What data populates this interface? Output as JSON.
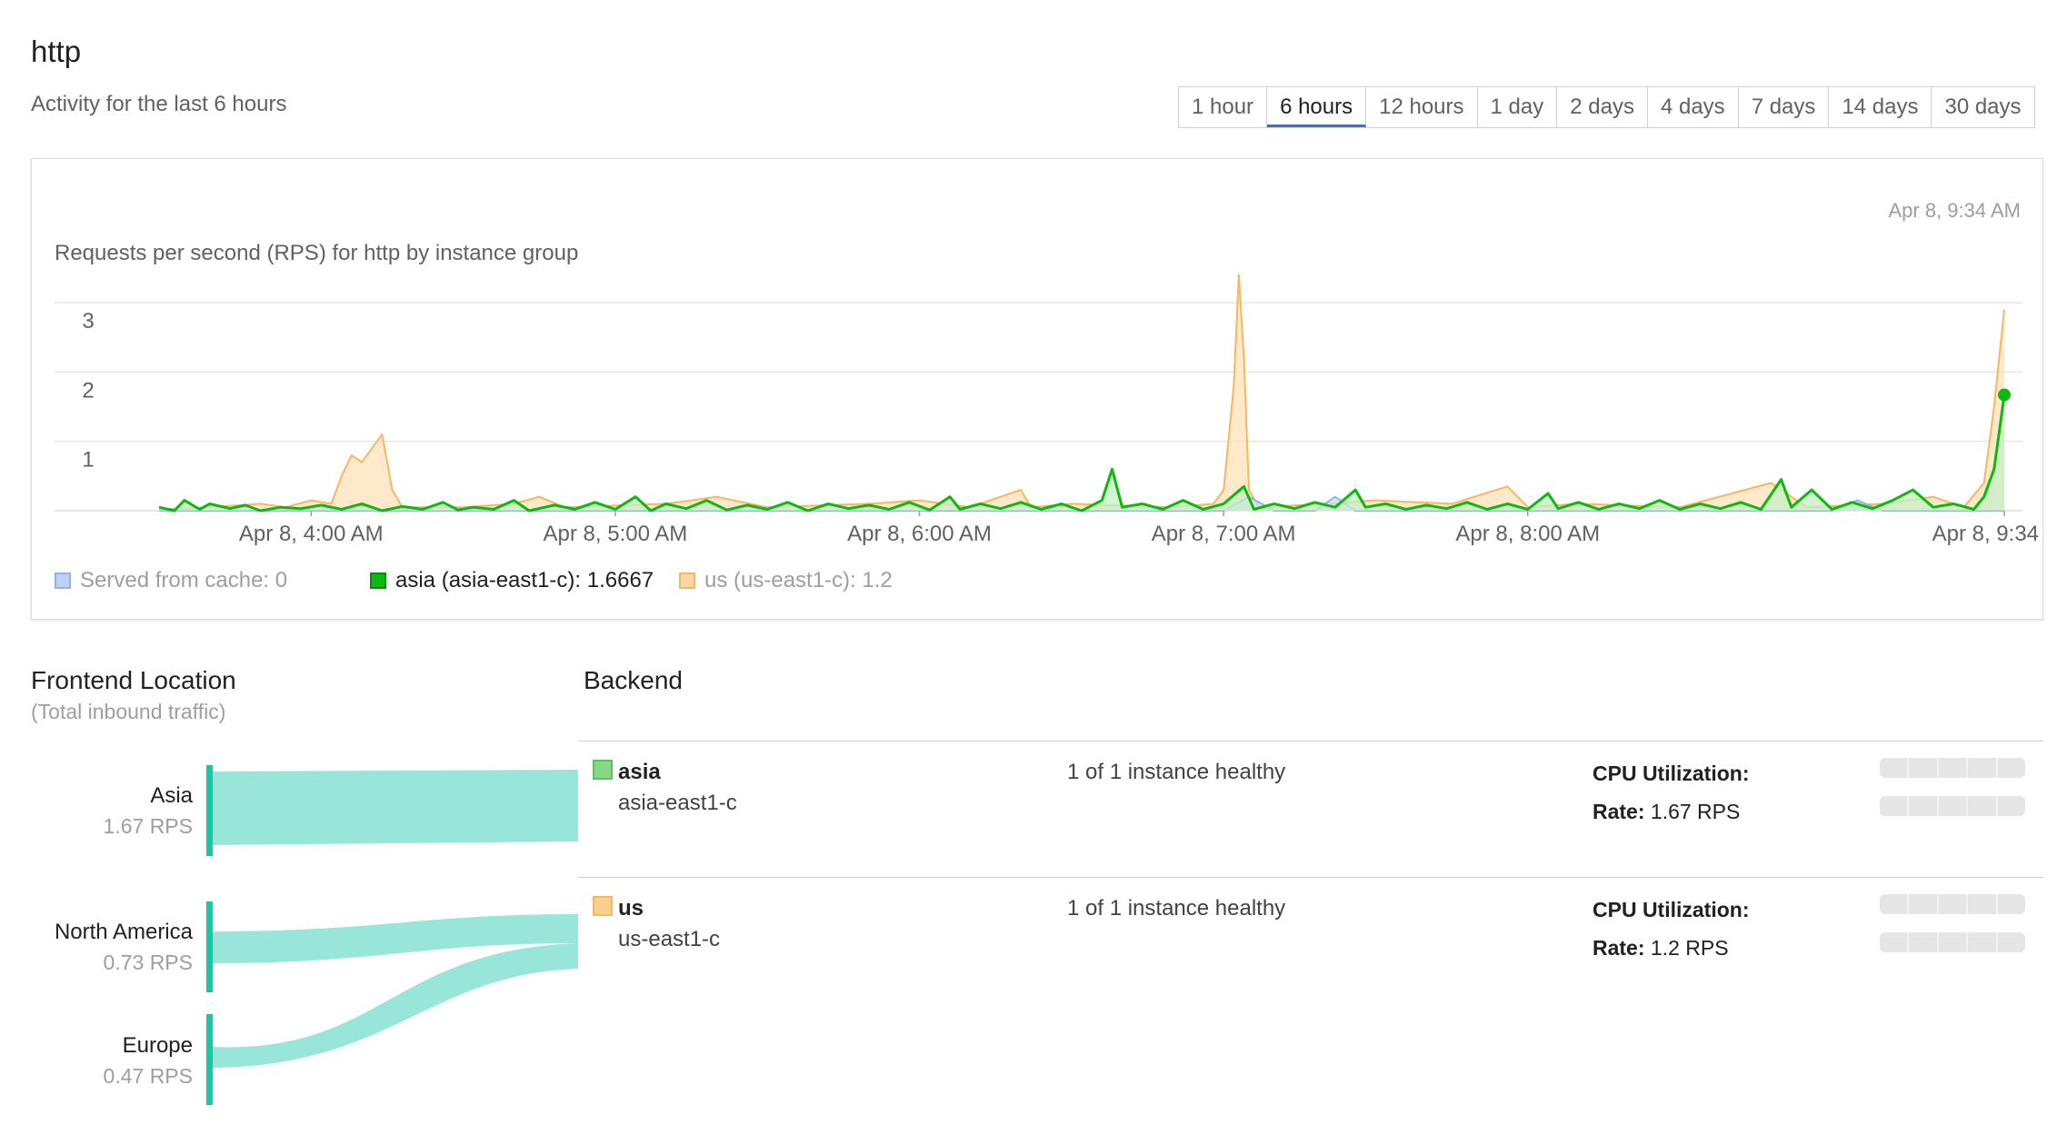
{
  "header": {
    "title": "http",
    "subtitle": "Activity for the last 6 hours"
  },
  "time_ranges": [
    {
      "label": "1 hour",
      "active": false
    },
    {
      "label": "6 hours",
      "active": true
    },
    {
      "label": "12 hours",
      "active": false
    },
    {
      "label": "1 day",
      "active": false
    },
    {
      "label": "2 days",
      "active": false
    },
    {
      "label": "4 days",
      "active": false
    },
    {
      "label": "7 days",
      "active": false
    },
    {
      "label": "14 days",
      "active": false
    },
    {
      "label": "30 days",
      "active": false
    }
  ],
  "chart": {
    "timestamp": "Apr 8, 9:34 AM",
    "title": "Requests per second (RPS) for http by instance group",
    "legend": {
      "cache": "Served from cache: 0",
      "asia": "asia (asia-east1-c): 1.6667",
      "us": "us (us-east1-c): 1.2"
    }
  },
  "chart_data": {
    "type": "area",
    "title": "Requests per second (RPS) for http by instance group",
    "x_tick_labels": [
      "Apr 8, 4:00 AM",
      "Apr 8, 5:00 AM",
      "Apr 8, 6:00 AM",
      "Apr 8, 7:00 AM",
      "Apr 8, 8:00 AM",
      "Apr 8, 9:34 AM"
    ],
    "x_ticks_min": [
      30,
      90,
      150,
      210,
      270,
      364
    ],
    "x_range_min": [
      0,
      364
    ],
    "y_ticks": [
      1,
      2,
      3
    ],
    "ylim": [
      0,
      3
    ],
    "grid": true,
    "legend_position": "bottom-left",
    "series": [
      {
        "name": "Served from cache",
        "color": "#8fb3ea",
        "points": [
          [
            0,
            0
          ],
          [
            210,
            0
          ],
          [
            215,
            0.2
          ],
          [
            220,
            0
          ],
          [
            228,
            0
          ],
          [
            232,
            0.2
          ],
          [
            236,
            0
          ],
          [
            330,
            0
          ],
          [
            335,
            0.15
          ],
          [
            340,
            0
          ],
          [
            364,
            0
          ]
        ]
      },
      {
        "name": "asia (asia-east1-c)",
        "color": "#0fb80f",
        "points": [
          [
            0,
            0.05
          ],
          [
            3,
            0
          ],
          [
            5,
            0.15
          ],
          [
            8,
            0.02
          ],
          [
            10,
            0.1
          ],
          [
            14,
            0.03
          ],
          [
            17,
            0.08
          ],
          [
            20,
            0
          ],
          [
            24,
            0.05
          ],
          [
            28,
            0.03
          ],
          [
            32,
            0.08
          ],
          [
            36,
            0.02
          ],
          [
            40,
            0.1
          ],
          [
            44,
            0
          ],
          [
            48,
            0.06
          ],
          [
            52,
            0.02
          ],
          [
            56,
            0.12
          ],
          [
            59,
            0.01
          ],
          [
            62,
            0.05
          ],
          [
            66,
            0.02
          ],
          [
            70,
            0.15
          ],
          [
            73,
            0
          ],
          [
            78,
            0.08
          ],
          [
            82,
            0.02
          ],
          [
            86,
            0.12
          ],
          [
            90,
            0.02
          ],
          [
            94,
            0.2
          ],
          [
            97,
            0
          ],
          [
            100,
            0.1
          ],
          [
            104,
            0.03
          ],
          [
            108,
            0.15
          ],
          [
            112,
            0.01
          ],
          [
            116,
            0.08
          ],
          [
            120,
            0.02
          ],
          [
            124,
            0.12
          ],
          [
            128,
            0
          ],
          [
            132,
            0.1
          ],
          [
            136,
            0.03
          ],
          [
            140,
            0.08
          ],
          [
            144,
            0.02
          ],
          [
            148,
            0.12
          ],
          [
            152,
            0.01
          ],
          [
            156,
            0.2
          ],
          [
            158,
            0.02
          ],
          [
            162,
            0.1
          ],
          [
            166,
            0.03
          ],
          [
            170,
            0.12
          ],
          [
            174,
            0.02
          ],
          [
            178,
            0.1
          ],
          [
            182,
            0
          ],
          [
            186,
            0.15
          ],
          [
            188,
            0.6
          ],
          [
            190,
            0.05
          ],
          [
            194,
            0.1
          ],
          [
            198,
            0.02
          ],
          [
            202,
            0.15
          ],
          [
            206,
            0.02
          ],
          [
            210,
            0.1
          ],
          [
            214,
            0.35
          ],
          [
            216,
            0.02
          ],
          [
            220,
            0.1
          ],
          [
            224,
            0.03
          ],
          [
            228,
            0.12
          ],
          [
            232,
            0.05
          ],
          [
            236,
            0.3
          ],
          [
            238,
            0.05
          ],
          [
            242,
            0.1
          ],
          [
            246,
            0.02
          ],
          [
            250,
            0.08
          ],
          [
            254,
            0.03
          ],
          [
            258,
            0.12
          ],
          [
            262,
            0.02
          ],
          [
            266,
            0.1
          ],
          [
            270,
            0.02
          ],
          [
            274,
            0.25
          ],
          [
            276,
            0.03
          ],
          [
            280,
            0.12
          ],
          [
            284,
            0.02
          ],
          [
            288,
            0.1
          ],
          [
            292,
            0.03
          ],
          [
            296,
            0.15
          ],
          [
            300,
            0.02
          ],
          [
            304,
            0.1
          ],
          [
            308,
            0.03
          ],
          [
            312,
            0.12
          ],
          [
            316,
            0.02
          ],
          [
            320,
            0.45
          ],
          [
            322,
            0.05
          ],
          [
            326,
            0.3
          ],
          [
            330,
            0.02
          ],
          [
            334,
            0.12
          ],
          [
            338,
            0.03
          ],
          [
            342,
            0.15
          ],
          [
            346,
            0.3
          ],
          [
            350,
            0.05
          ],
          [
            354,
            0.1
          ],
          [
            358,
            0.02
          ],
          [
            360,
            0.2
          ],
          [
            362,
            0.6
          ],
          [
            364,
            1.67
          ]
        ]
      },
      {
        "name": "us (us-east1-c)",
        "color": "#f5b761",
        "points": [
          [
            0,
            0.02
          ],
          [
            10,
            0.05
          ],
          [
            20,
            0.1
          ],
          [
            25,
            0.05
          ],
          [
            30,
            0.15
          ],
          [
            34,
            0.1
          ],
          [
            36,
            0.5
          ],
          [
            38,
            0.8
          ],
          [
            40,
            0.7
          ],
          [
            42,
            0.9
          ],
          [
            44,
            1.1
          ],
          [
            46,
            0.3
          ],
          [
            48,
            0.05
          ],
          [
            60,
            0.05
          ],
          [
            70,
            0.1
          ],
          [
            75,
            0.2
          ],
          [
            80,
            0.05
          ],
          [
            100,
            0.1
          ],
          [
            110,
            0.2
          ],
          [
            120,
            0.05
          ],
          [
            140,
            0.1
          ],
          [
            150,
            0.15
          ],
          [
            160,
            0.05
          ],
          [
            170,
            0.3
          ],
          [
            172,
            0.05
          ],
          [
            180,
            0.1
          ],
          [
            200,
            0.05
          ],
          [
            208,
            0.1
          ],
          [
            210,
            0.3
          ],
          [
            212,
            1.8
          ],
          [
            213,
            3.4
          ],
          [
            214,
            2.2
          ],
          [
            215,
            0.3
          ],
          [
            217,
            0.05
          ],
          [
            230,
            0.1
          ],
          [
            240,
            0.15
          ],
          [
            255,
            0.1
          ],
          [
            266,
            0.35
          ],
          [
            270,
            0.05
          ],
          [
            280,
            0.1
          ],
          [
            300,
            0.05
          ],
          [
            318,
            0.4
          ],
          [
            322,
            0.2
          ],
          [
            325,
            0.05
          ],
          [
            340,
            0.1
          ],
          [
            350,
            0.2
          ],
          [
            356,
            0.05
          ],
          [
            360,
            0.4
          ],
          [
            362,
            1.5
          ],
          [
            364,
            2.9
          ]
        ]
      }
    ]
  },
  "frontend": {
    "title": "Frontend Location",
    "subtitle": "(Total inbound traffic)",
    "locations": [
      {
        "name": "Asia",
        "rps": "1.67 RPS"
      },
      {
        "name": "North America",
        "rps": "0.73 RPS"
      },
      {
        "name": "Europe",
        "rps": "0.47 RPS"
      }
    ]
  },
  "backend": {
    "title": "Backend",
    "groups": [
      {
        "name": "asia",
        "zone": "asia-east1-c",
        "health": "1 of 1 instance healthy",
        "cpu_label": "CPU Utilization:",
        "rate_label": "Rate:",
        "rate_value": "1.67 RPS",
        "color": "#86d886"
      },
      {
        "name": "us",
        "zone": "us-east1-c",
        "health": "1 of 1 instance healthy",
        "cpu_label": "CPU Utilization:",
        "rate_label": "Rate:",
        "rate_value": "1.2 RPS",
        "color": "#f9cf8e"
      }
    ]
  },
  "colors": {
    "accent": "#3b6fd6",
    "flow": "#97e6d9",
    "flow_bar": "#17c7a5"
  }
}
